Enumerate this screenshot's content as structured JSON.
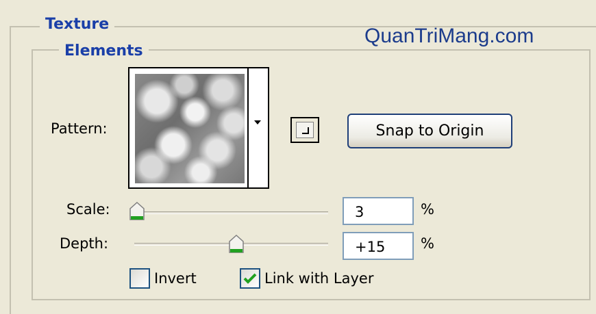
{
  "watermark": "QuanTriMang.com",
  "groups": {
    "texture_title": "Texture",
    "elements_title": "Elements"
  },
  "pattern": {
    "label": "Pattern:",
    "snap_button": "Snap to Origin"
  },
  "scale": {
    "label": "Scale:",
    "value": "3",
    "unit": "%",
    "slider_fraction": 0.03
  },
  "depth": {
    "label": "Depth:",
    "value": "+15",
    "unit": "%",
    "slider_fraction": 0.53
  },
  "options": {
    "invert_label": "Invert",
    "invert_checked": false,
    "link_label": "Link with Layer",
    "link_checked": true
  },
  "colors": {
    "background": "#ece9d8",
    "group_title": "#1a3fa8",
    "check": "#21a121",
    "slider_thumb_bottom": "#21a121"
  }
}
